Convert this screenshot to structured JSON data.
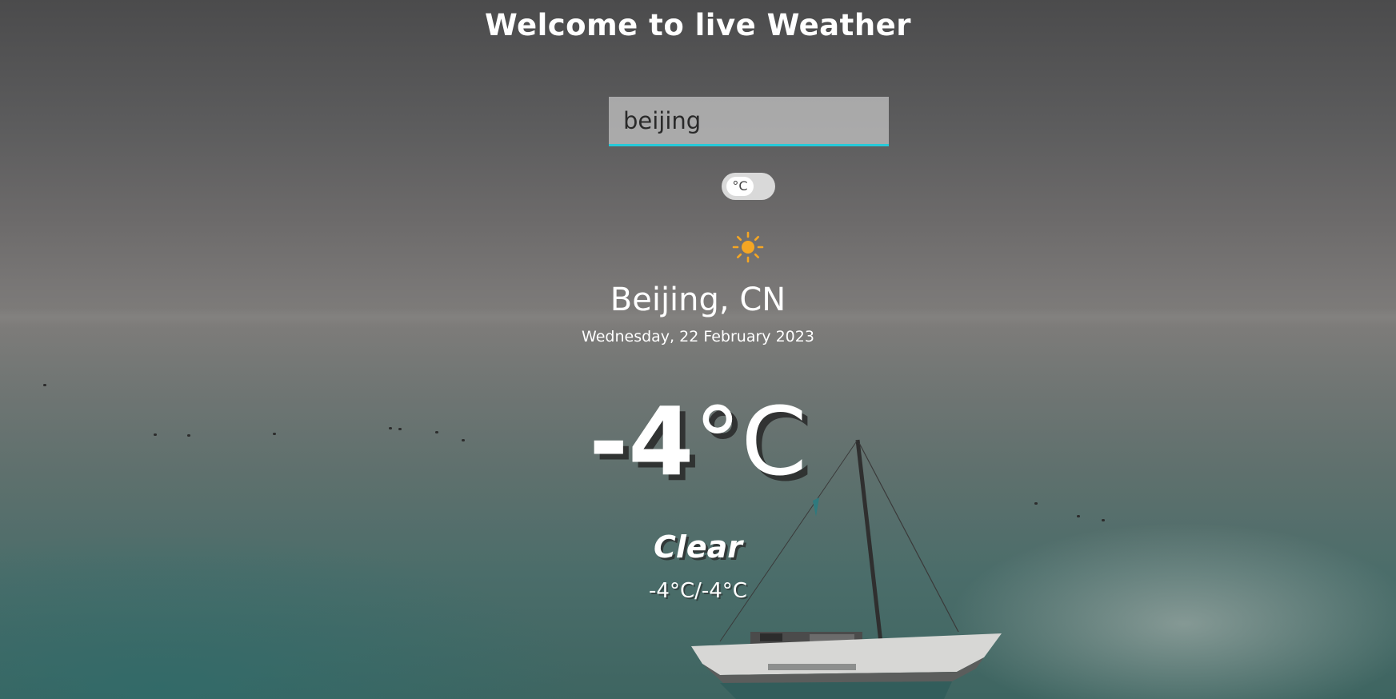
{
  "header": {
    "title": "Welcome to live Weather"
  },
  "search": {
    "value": "beijing"
  },
  "unit_toggle": {
    "label": "°C"
  },
  "weather": {
    "icon": "sun-icon",
    "icon_color": "#f5a623",
    "location": "Beijing, CN",
    "date": "Wednesday, 22 February 2023",
    "temperature_value": "-4",
    "temperature_unit": "°C",
    "condition": "Clear",
    "range": "-4°C/-4°C"
  },
  "colors": {
    "accent": "#27c9d8",
    "text": "#ffffff"
  }
}
